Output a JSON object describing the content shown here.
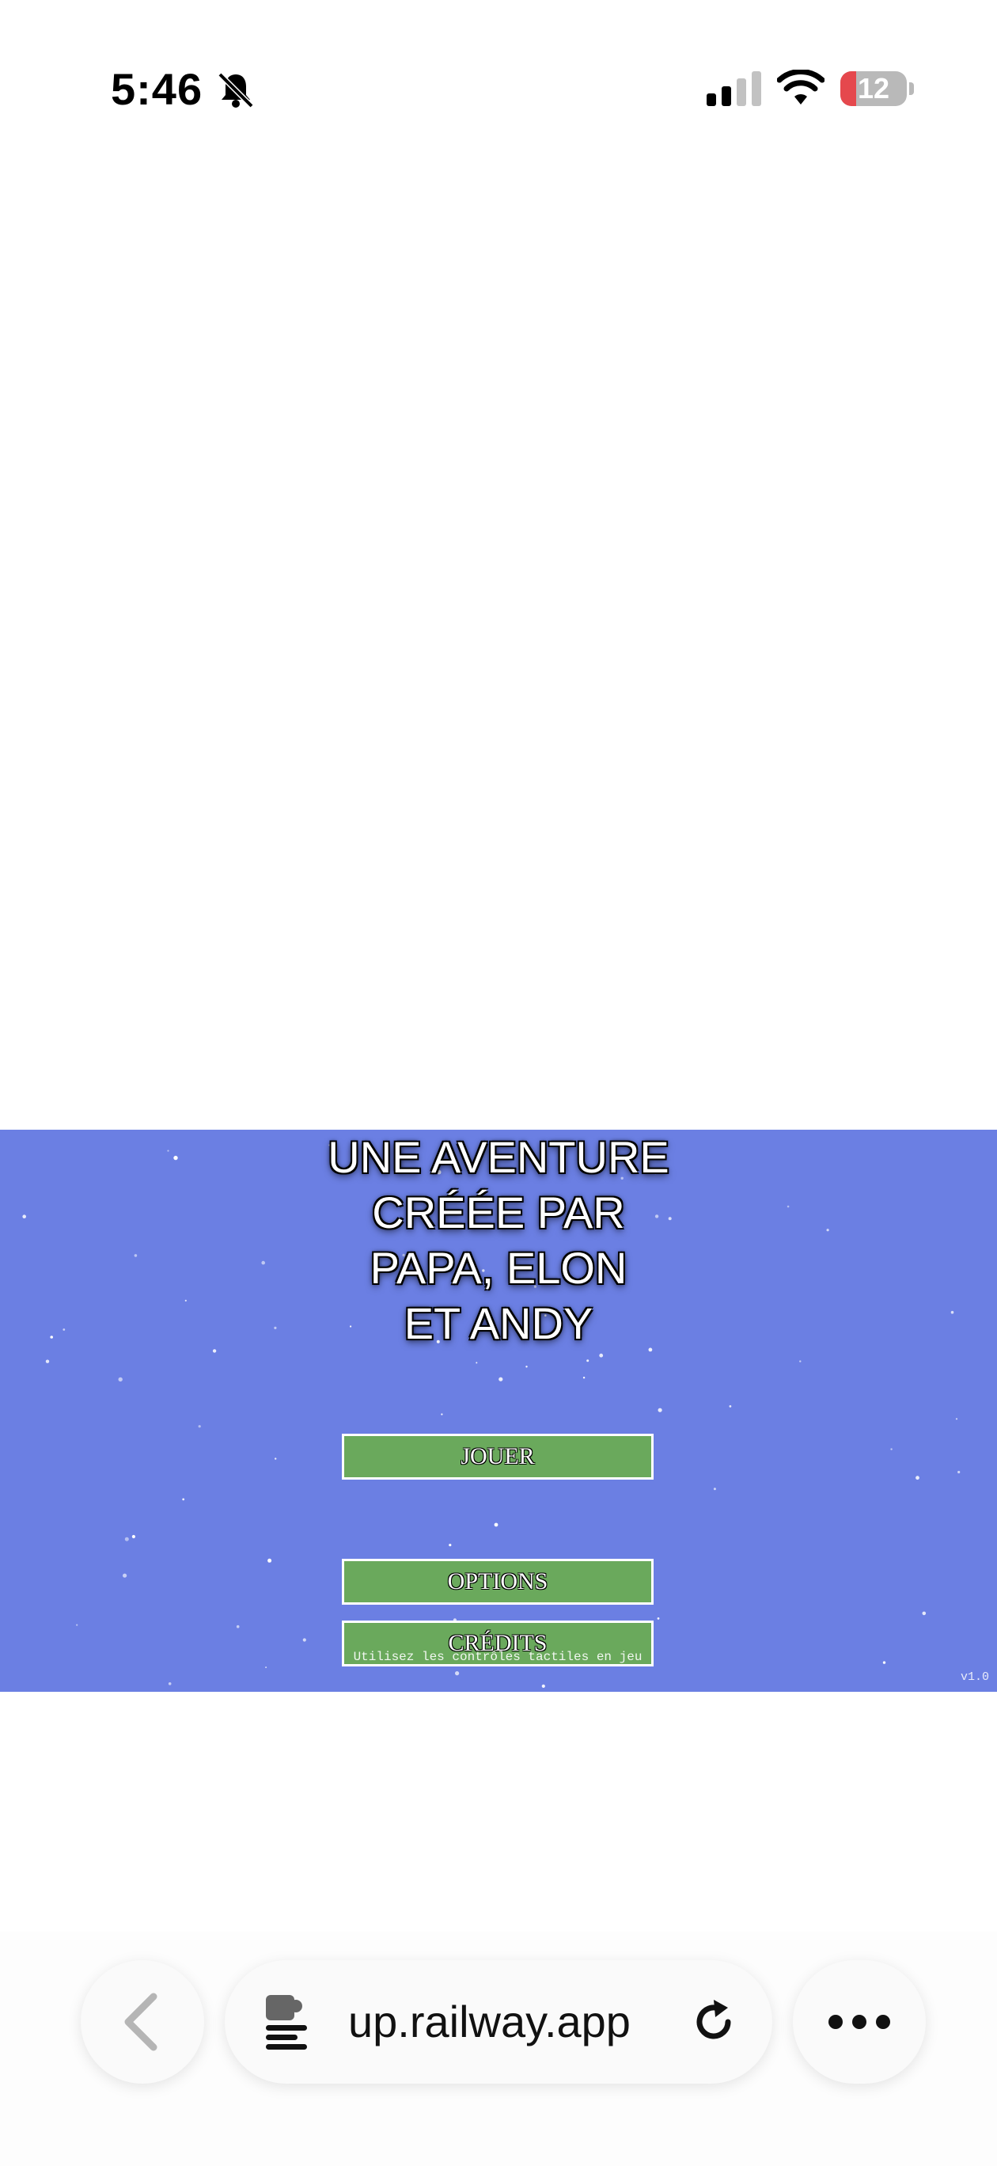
{
  "status": {
    "time": "5:46",
    "battery_level": "12",
    "battery_fraction": 0.12
  },
  "game": {
    "title_lines": [
      "UNE AVENTURE",
      "CRÉÉE PAR",
      "PAPA, ELON",
      "ET ANDY"
    ],
    "buttons": {
      "play": "JOUER",
      "options": "OPTIONS",
      "credits": "CRÉDITS"
    },
    "hint": "Utilisez les contrôles tactiles en jeu",
    "version": "v1.0",
    "colors": {
      "background": "#6b7fe3",
      "button": "#6aa95c"
    }
  },
  "browser": {
    "url": "up.railway.app"
  }
}
